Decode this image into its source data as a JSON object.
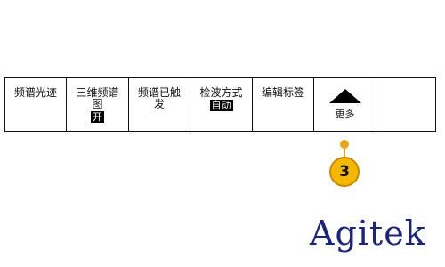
{
  "menu": {
    "items": [
      {
        "lines": [
          "频谱光迹"
        ]
      },
      {
        "lines": [
          "三维频谱",
          "图"
        ],
        "badge": "开"
      },
      {
        "lines": [
          "频谱已触",
          "发"
        ]
      },
      {
        "lines": [
          "检波方式"
        ],
        "badge": "自动"
      },
      {
        "lines": [
          "编辑标签"
        ]
      }
    ],
    "more": {
      "label": "更多",
      "icon": "up-arrow-icon"
    }
  },
  "callout": {
    "number": "3",
    "color": "#f5b800"
  },
  "logo": {
    "text": "Agitek",
    "color": "#1a237e"
  }
}
